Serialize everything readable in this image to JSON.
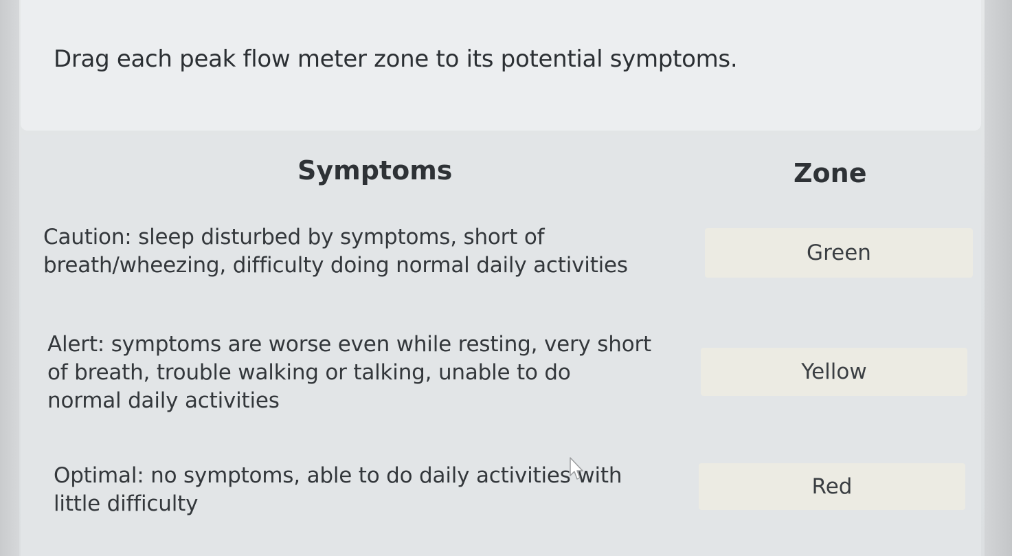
{
  "prompt": {
    "text": "Drag each peak flow meter zone to its potential symptoms."
  },
  "columns": {
    "symptoms_header": "Symptoms",
    "zone_header": "Zone"
  },
  "symptoms": [
    {
      "lines": [
        "Caution: sleep disturbed by symptoms, short of",
        "breath/wheezing, difficulty doing normal daily activities"
      ]
    },
    {
      "lines": [
        "Alert: symptoms are worse even while resting, very short",
        "of breath, trouble walking or talking, unable to do",
        "normal daily activities"
      ]
    },
    {
      "lines": [
        "Optimal: no symptoms, able to do daily activities with",
        "little difficulty"
      ]
    }
  ],
  "zones": [
    {
      "label": "Green"
    },
    {
      "label": "Yellow"
    },
    {
      "label": "Red"
    }
  ],
  "icons": {
    "cursor": "mouse-pointer-icon"
  }
}
